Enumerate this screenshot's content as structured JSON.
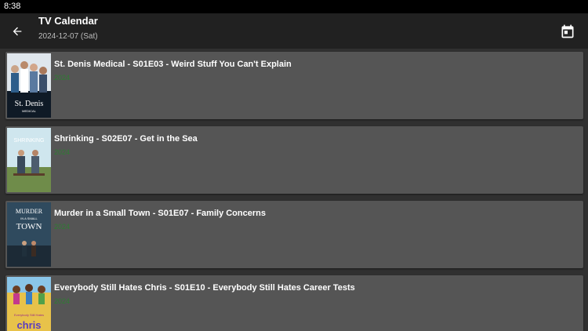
{
  "status_bar": {
    "time": "8:38"
  },
  "app_bar": {
    "title": "TV Calendar",
    "subtitle": "2024-12-07 (Sat)",
    "back_icon": "arrow-back-icon",
    "calendar_icon": "calendar-icon"
  },
  "colors": {
    "year_text": "#2e7d32",
    "card_bg": "#555555",
    "app_bar_bg": "#212121"
  },
  "episodes": [
    {
      "title": "St. Denis Medical - S01E03 - Weird Stuff You Can't Explain",
      "year": "2024",
      "poster_text": "St. Denis",
      "poster_subtext": "MEDICAL"
    },
    {
      "title": "Shrinking - S02E07 - Get in the Sea",
      "year": "2024",
      "poster_text": "SHRINKING"
    },
    {
      "title": "Murder in a Small Town - S01E07 - Family Concerns",
      "year": "2024",
      "poster_text": "MURDER",
      "poster_subtext": "IN A SMALL",
      "poster_subtext2": "TOWN"
    },
    {
      "title": "Everybody Still Hates Chris - S01E10 - Everybody Still Hates Career Tests",
      "year": "2024",
      "poster_text": "Everybody Still Hates",
      "poster_subtext": "chris"
    }
  ]
}
